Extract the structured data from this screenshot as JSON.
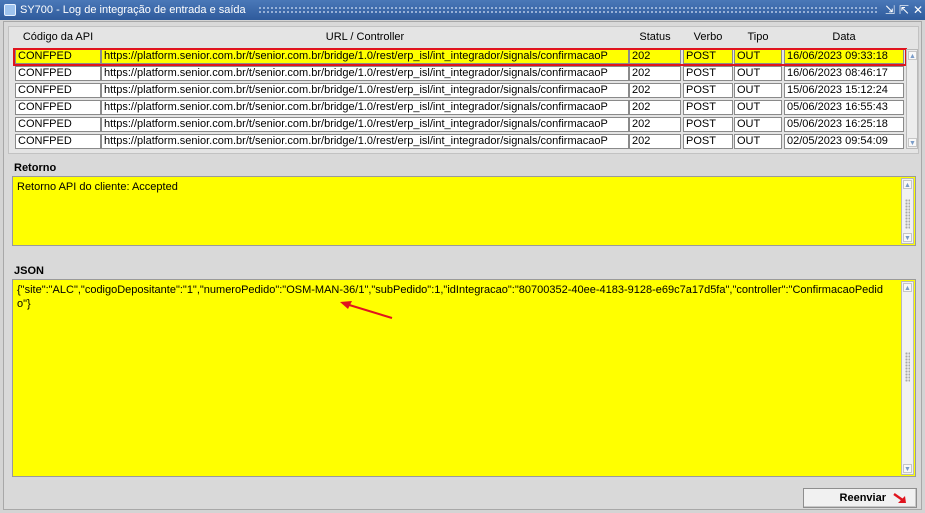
{
  "window": {
    "title": "SY700 - Log de integração de entrada e saída",
    "controls": [
      "minimize-icon",
      "restore-icon",
      "close-icon"
    ]
  },
  "grid": {
    "headers": {
      "codigo": "Código da API",
      "url": "URL / Controller",
      "status": "Status",
      "verbo": "Verbo",
      "tipo": "Tipo",
      "data": "Data"
    },
    "rows": [
      {
        "codigo": "CONFPED",
        "url": "https://platform.senior.com.br/t/senior.com.br/bridge/1.0/rest/erp_isl/int_integrador/signals/confirmacaoP",
        "status": "202",
        "verbo": "POST",
        "tipo": "OUT",
        "data": "16/06/2023 09:33:18",
        "selected": true
      },
      {
        "codigo": "CONFPED",
        "url": "https://platform.senior.com.br/t/senior.com.br/bridge/1.0/rest/erp_isl/int_integrador/signals/confirmacaoP",
        "status": "202",
        "verbo": "POST",
        "tipo": "OUT",
        "data": "16/06/2023 08:46:17",
        "selected": false
      },
      {
        "codigo": "CONFPED",
        "url": "https://platform.senior.com.br/t/senior.com.br/bridge/1.0/rest/erp_isl/int_integrador/signals/confirmacaoP",
        "status": "202",
        "verbo": "POST",
        "tipo": "OUT",
        "data": "15/06/2023 15:12:24",
        "selected": false
      },
      {
        "codigo": "CONFPED",
        "url": "https://platform.senior.com.br/t/senior.com.br/bridge/1.0/rest/erp_isl/int_integrador/signals/confirmacaoP",
        "status": "202",
        "verbo": "POST",
        "tipo": "OUT",
        "data": "05/06/2023 16:55:43",
        "selected": false
      },
      {
        "codigo": "CONFPED",
        "url": "https://platform.senior.com.br/t/senior.com.br/bridge/1.0/rest/erp_isl/int_integrador/signals/confirmacaoP",
        "status": "202",
        "verbo": "POST",
        "tipo": "OUT",
        "data": "05/06/2023 16:25:18",
        "selected": false
      },
      {
        "codigo": "CONFPED",
        "url": "https://platform.senior.com.br/t/senior.com.br/bridge/1.0/rest/erp_isl/int_integrador/signals/confirmacaoP",
        "status": "202",
        "verbo": "POST",
        "tipo": "OUT",
        "data": "02/05/2023 09:54:09",
        "selected": false
      }
    ]
  },
  "retorno": {
    "label": "Retorno",
    "text": "Retorno API do cliente: Accepted"
  },
  "json": {
    "label": "JSON",
    "text": "{\"site\":\"ALC\",\"codigoDepositante\":\"1\",\"numeroPedido\":\"OSM-MAN-36/1\",\"subPedido\":1,\"idIntegracao\":\"80700352-40ee-4183-9128-e69c7a17d5fa\",\"controller\":\"ConfirmacaoPedido\"}"
  },
  "actions": {
    "reenviar": "Reenviar"
  },
  "colors": {
    "highlight": "#ffff00",
    "annotation": "#e0141e",
    "titlebar": "#2f5b9c"
  }
}
